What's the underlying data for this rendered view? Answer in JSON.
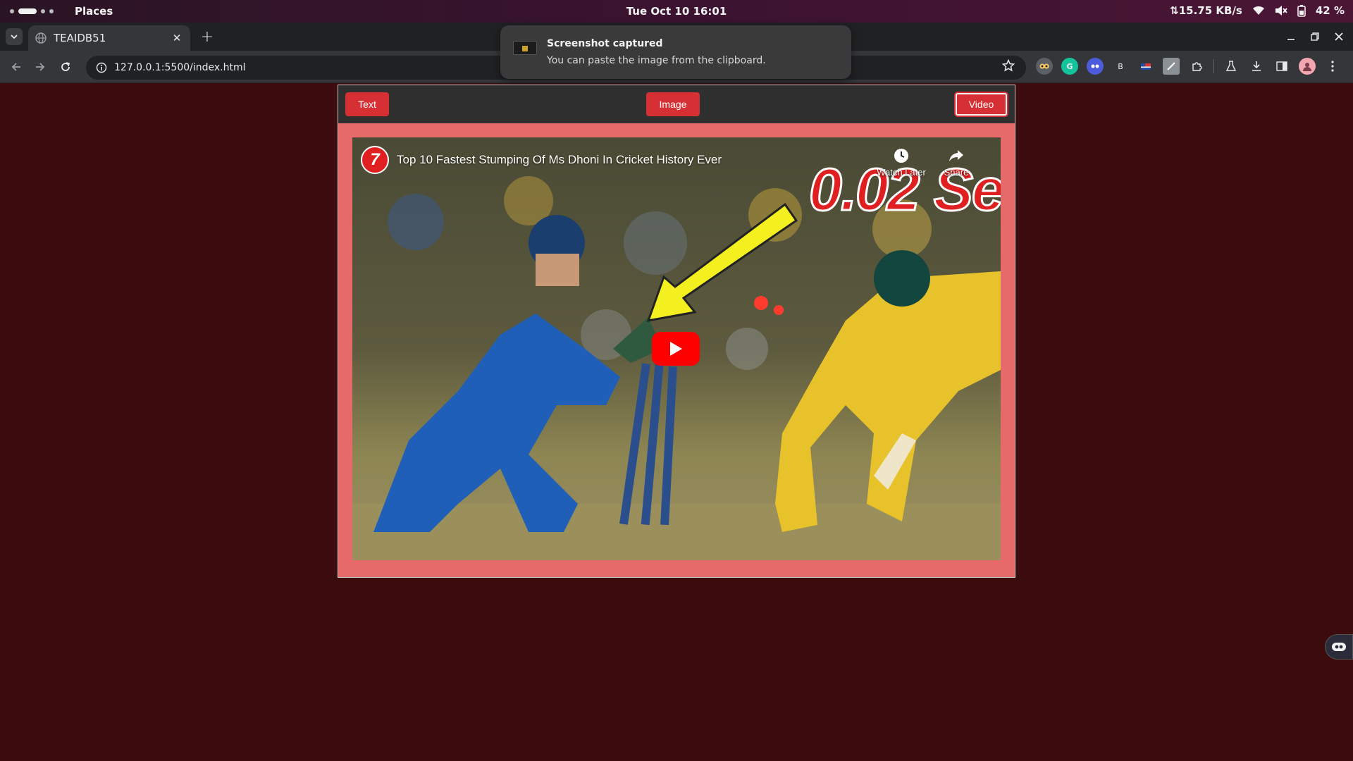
{
  "topbar": {
    "activities": "workspaces",
    "places_label": "Places",
    "clock": "Tue Oct 10  16:01",
    "net_speed": "⇅15.75 KB/s",
    "battery_percent": "42 %"
  },
  "browser": {
    "tab": {
      "title": "TEAIDB51",
      "close_glyph": "✕"
    },
    "new_tab_glyph": "+",
    "url": "127.0.0.1:5500/index.html",
    "extensions": [
      "owl-extension-icon",
      "grammarly-icon",
      "copilot-icon",
      "b-extension-icon",
      "flag-extension-icon",
      "sheet-extension-icon",
      "puzzle-icon",
      "labs-icon",
      "download-icon",
      "sidepanel-icon",
      "profile-avatar"
    ],
    "ext_b_label": "B"
  },
  "notification": {
    "title": "Screenshot captured",
    "body": "You can paste the image from the clipboard."
  },
  "page": {
    "nav": {
      "text_label": "Text",
      "image_label": "Image",
      "video_label": "Video",
      "active": "Video"
    },
    "video": {
      "channel_logo": "7",
      "title": "Top 10 Fastest Stumping Of Ms Dhoni In Cricket History Ever",
      "overlay_text": "0.02 Se",
      "watch_later_label": "Watch Later",
      "share_label": "Share"
    }
  },
  "colors": {
    "page_bg": "#3c0b0d",
    "button_red": "#d63034",
    "frame_pink": "#e66a6a",
    "youtube_red": "#ff0000"
  }
}
